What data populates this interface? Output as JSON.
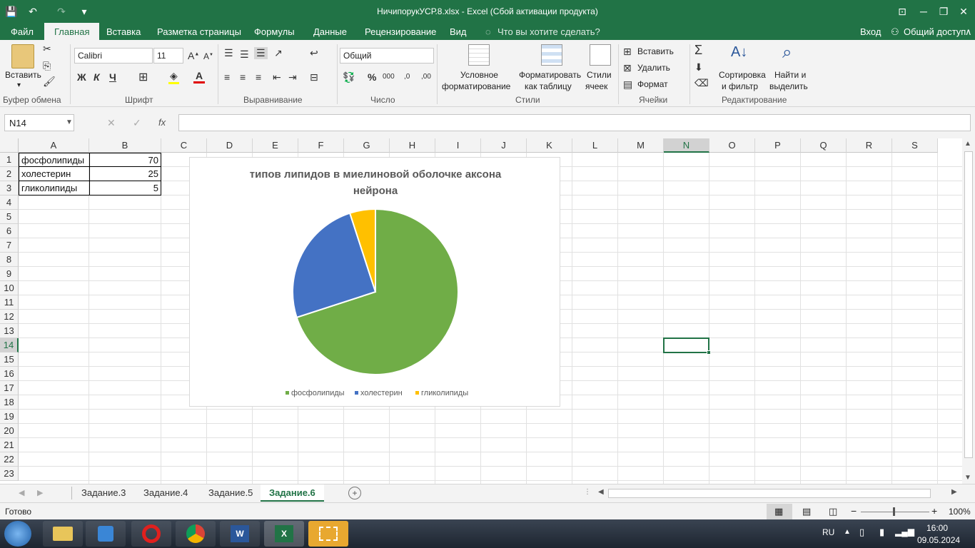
{
  "window": {
    "title": "НичипорукУСР.8.xlsx - Excel (Сбой активации продукта)"
  },
  "ribbon_tabs": [
    "Файл",
    "Главная",
    "Вставка",
    "Разметка страницы",
    "Формулы",
    "Данные",
    "Рецензирование",
    "Вид"
  ],
  "tell_me": "Что вы хотите сделать?",
  "signin": "Вход",
  "share": "Общий доступ",
  "ribbon": {
    "clipboard": {
      "paste": "Вставить",
      "label": "Буфер обмена"
    },
    "font": {
      "name": "Calibri",
      "size": "11",
      "label": "Шрифт",
      "bold": "Ж",
      "italic": "К",
      "underline": "Ч"
    },
    "alignment": {
      "label": "Выравнивание"
    },
    "number": {
      "format": "Общий",
      "label": "Число",
      "percent": "%",
      "thousands": "000"
    },
    "styles": {
      "cond1": "Условное",
      "cond2": "форматирование",
      "fmt1": "Форматировать",
      "fmt2": "как таблицу",
      "sty1": "Стили",
      "sty2": "ячеек",
      "label": "Стили"
    },
    "cells": {
      "insert": "Вставить",
      "delete": "Удалить",
      "format": "Формат",
      "label": "Ячейки"
    },
    "editing": {
      "sort1": "Сортировка",
      "sort2": "и фильтр",
      "find1": "Найти и",
      "find2": "выделить",
      "label": "Редактирование"
    }
  },
  "formula_bar": {
    "name_box": "N14",
    "fx": "fx",
    "value": ""
  },
  "columns": [
    "A",
    "B",
    "C",
    "D",
    "E",
    "F",
    "G",
    "H",
    "I",
    "J",
    "K",
    "L",
    "M",
    "N",
    "O",
    "P",
    "Q",
    "R",
    "S"
  ],
  "rows": [
    "1",
    "2",
    "3",
    "4",
    "5",
    "6",
    "7",
    "8",
    "9",
    "10",
    "11",
    "12",
    "13",
    "14",
    "15",
    "16",
    "17",
    "18",
    "19",
    "20",
    "21",
    "22",
    "23"
  ],
  "cells": {
    "A1": "фосфолипиды",
    "B1": "70",
    "A2": "холестерин",
    "B2": "25",
    "A3": "гликолипиды",
    "B3": "5"
  },
  "selected_cell": "N14",
  "chart_data": {
    "type": "pie",
    "title": "типов липидов в миелиновой оболочке аксона нейрона",
    "categories": [
      "фосфолипиды",
      "холестерин",
      "гликолипиды"
    ],
    "values": [
      70,
      25,
      5
    ],
    "colors": [
      "#70ad47",
      "#4472c4",
      "#ffc000"
    ],
    "legend": "bottom"
  },
  "sheets": [
    "Задание.3",
    "Задание.4",
    "Задание.5",
    "Задание.6"
  ],
  "active_sheet": "Задание.6",
  "status": {
    "ready": "Готово",
    "zoom": "100%"
  },
  "taskbar": {
    "lang": "RU",
    "time": "16:00",
    "date": "09.05.2024"
  }
}
